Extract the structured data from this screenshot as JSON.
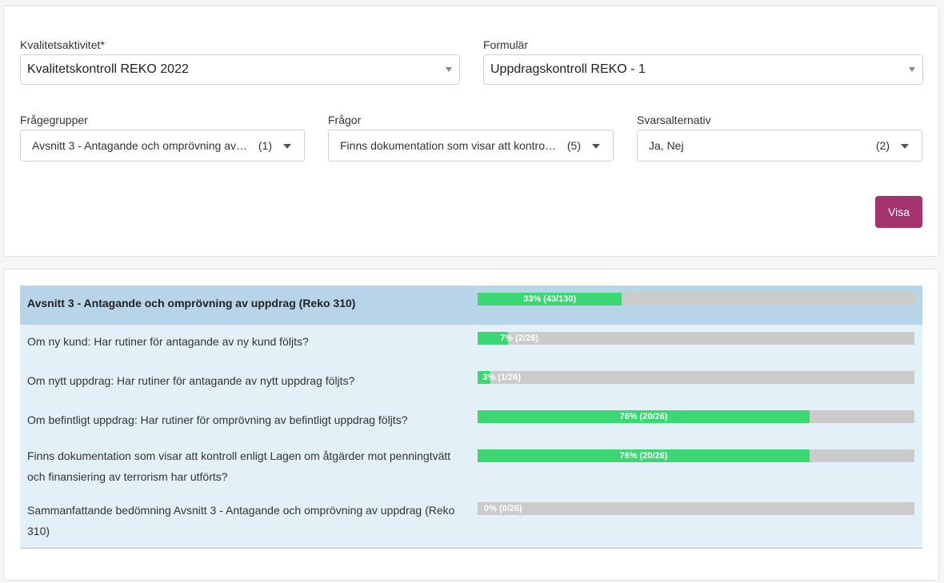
{
  "filters": {
    "kvalitetsaktivitet": {
      "label": "Kvalitetsaktivitet*",
      "value": "Kvalitetskontroll REKO 2022"
    },
    "formular": {
      "label": "Formulär",
      "value": "Uppdragskontroll REKO - 1"
    },
    "fragegrupper": {
      "label": "Frågegrupper",
      "value": "Avsnitt 3 - Antagande och omprövning av uppdrag (Reko 310)",
      "count": "(1)"
    },
    "fragor": {
      "label": "Frågor",
      "value": "Finns dokumentation som visar att kontroll enligt Lagen om åtgärder mot penningtvätt",
      "count": "(5)"
    },
    "svarsalternativ": {
      "label": "Svarsalternativ",
      "value": "Ja, Nej",
      "count": "(2)"
    },
    "visa_label": "Visa"
  },
  "results": {
    "group": {
      "title": "Avsnitt 3 - Antagande och omprövning av uppdrag (Reko 310)",
      "percent": 33,
      "label": "33% (43/130)"
    },
    "questions": [
      {
        "text": "Om ny kund: Har rutiner för antagande av ny kund följts?",
        "percent": 7,
        "label": "7% (2/26)"
      },
      {
        "text": "Om nytt uppdrag: Har rutiner för antagande av nytt uppdrag följts?",
        "percent": 3,
        "label": "3% (1/26)"
      },
      {
        "text": "Om befintligt uppdrag: Har rutiner för omprövning av befintligt uppdrag följts?",
        "percent": 76,
        "label": "76% (20/26)"
      },
      {
        "text": "Finns dokumentation som visar att kontroll enligt Lagen om åtgärder mot penningtvätt och finansiering av terrorism har utförts?",
        "percent": 76,
        "label": "76% (20/26)"
      },
      {
        "text": "Sammanfattande bedömning Avsnitt 3 - Antagande och omprövning av uppdrag (Reko 310)",
        "percent": 0,
        "label": "0% (0/26)"
      }
    ]
  },
  "colors": {
    "accent": "#a3346e",
    "bar_fill": "#3ad773",
    "bar_track": "#cbcbcb",
    "group_row": "#b8d4e8",
    "question_row": "#e4f0f8"
  }
}
